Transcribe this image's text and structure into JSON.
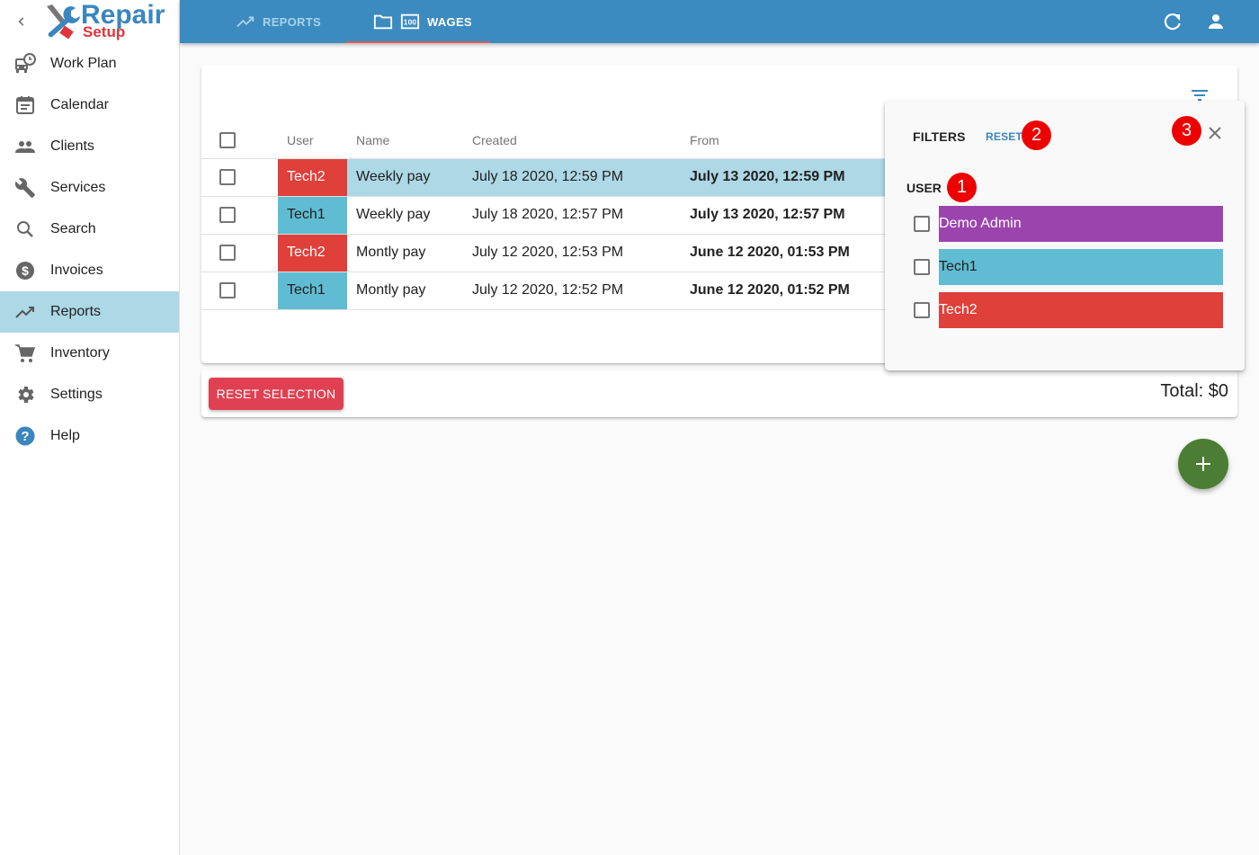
{
  "app": {
    "logo_word1": "Repair",
    "logo_word2": "Setup"
  },
  "sidebar": {
    "items": [
      {
        "label": "Work Plan",
        "icon": "bus-clock-icon",
        "active": false
      },
      {
        "label": "Calendar",
        "icon": "calendar-icon",
        "active": false
      },
      {
        "label": "Clients",
        "icon": "people-icon",
        "active": false
      },
      {
        "label": "Services",
        "icon": "wrench-icon",
        "active": false
      },
      {
        "label": "Search",
        "icon": "search-icon",
        "active": false
      },
      {
        "label": "Invoices",
        "icon": "dollar-circle-icon",
        "active": false
      },
      {
        "label": "Reports",
        "icon": "trending-up-icon",
        "active": true
      },
      {
        "label": "Inventory",
        "icon": "cart-icon",
        "active": false
      },
      {
        "label": "Settings",
        "icon": "gear-icon",
        "active": false
      },
      {
        "label": "Help",
        "icon": "help-circle-icon",
        "active": false
      }
    ]
  },
  "topbar": {
    "tabs": [
      {
        "label": "REPORTS",
        "active": false
      },
      {
        "label": "WAGES",
        "active": true
      }
    ],
    "accent": "#3c8bc0",
    "tab_indicator": "#e25a5a"
  },
  "table": {
    "headers": [
      "User",
      "Name",
      "Created",
      "From"
    ],
    "rows": [
      {
        "user": "Tech2",
        "user_color": "#e0403a",
        "user_text": "#ffffff",
        "name": "Weekly pay",
        "created": "July 18 2020, 12:59 PM",
        "from": "July 13 2020, 12:59 PM",
        "selected": true
      },
      {
        "user": "Tech1",
        "user_color": "#5fbcd3",
        "user_text": "#212121",
        "name": "Weekly pay",
        "created": "July 18 2020, 12:57 PM",
        "from": "July 13 2020, 12:57 PM",
        "selected": false
      },
      {
        "user": "Tech2",
        "user_color": "#e0403a",
        "user_text": "#ffffff",
        "name": "Montly pay",
        "created": "July 12 2020, 12:53 PM",
        "from": "June 12 2020, 01:53 PM",
        "selected": false
      },
      {
        "user": "Tech1",
        "user_color": "#5fbcd3",
        "user_text": "#212121",
        "name": "Montly pay",
        "created": "July 12 2020, 12:52 PM",
        "from": "June 12 2020, 01:52 PM",
        "selected": false
      }
    ]
  },
  "footer": {
    "reset_selection_label": "RESET SELECTION",
    "total_label": "Total: $0"
  },
  "filters": {
    "title": "FILTERS",
    "reset_label": "RESET",
    "user_label": "USER",
    "badges": [
      "1",
      "2",
      "3"
    ],
    "users": [
      {
        "label": "Demo Admin",
        "color": "#9b44ad",
        "text": "#ffffff"
      },
      {
        "label": "Tech1",
        "color": "#5fbcd3",
        "text": "#212121"
      },
      {
        "label": "Tech2",
        "color": "#e0403a",
        "text": "#ffffff"
      }
    ]
  }
}
